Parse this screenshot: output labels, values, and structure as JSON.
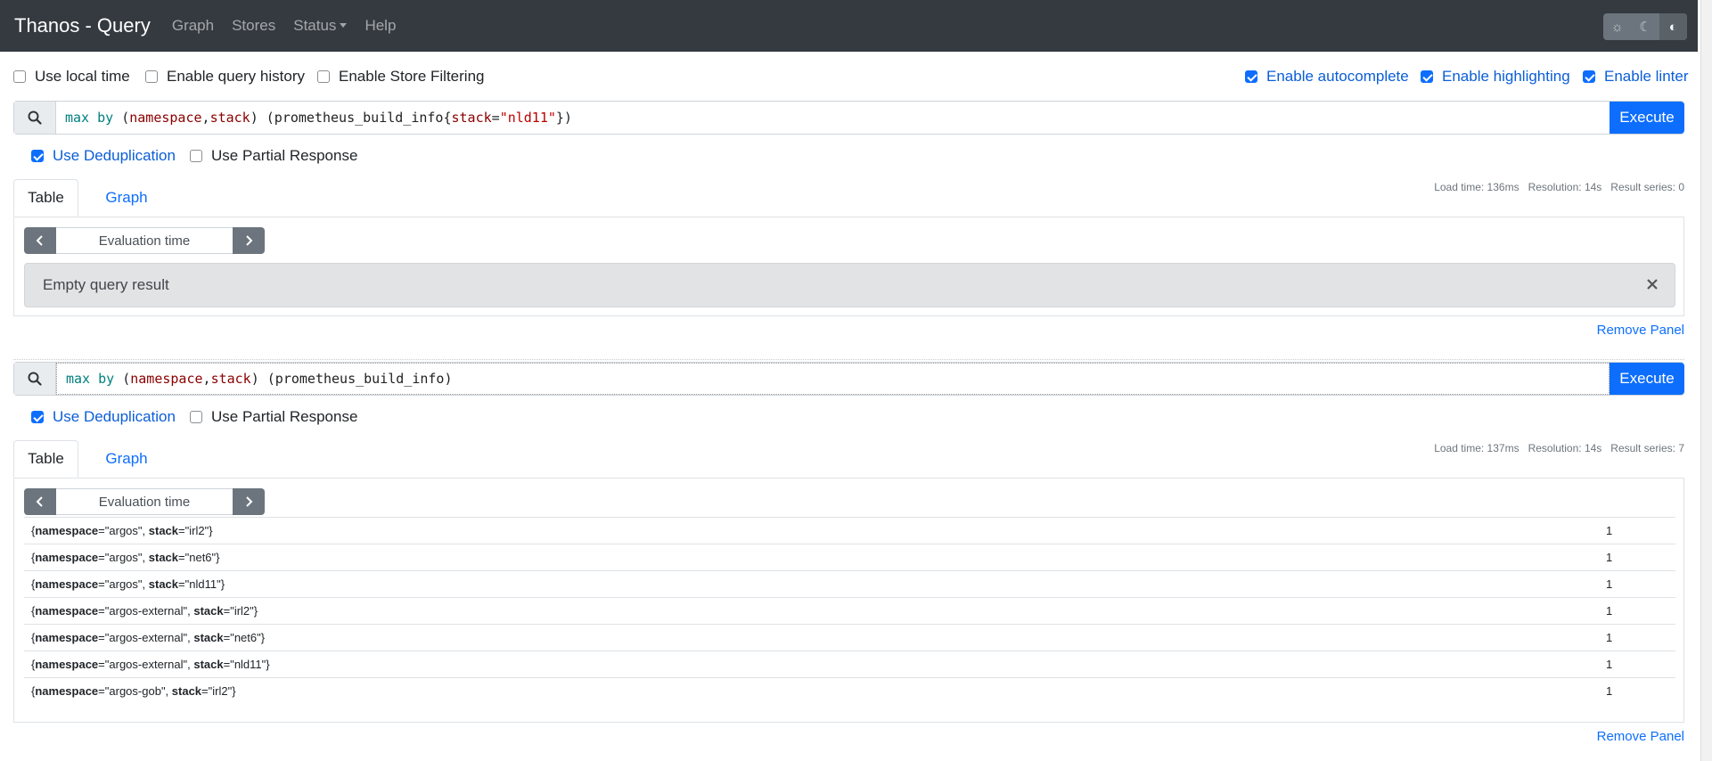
{
  "nav": {
    "brand": "Thanos - Query",
    "links": [
      "Graph",
      "Stores",
      "Status",
      "Help"
    ]
  },
  "theme": {
    "icons": [
      "☼",
      "☾",
      "◐"
    ]
  },
  "options": {
    "use_local_time": "Use local time",
    "enable_query_history": "Enable query history",
    "enable_store_filtering": "Enable Store Filtering",
    "enable_autocomplete": "Enable autocomplete",
    "enable_highlighting": "Enable highlighting",
    "enable_linter": "Enable linter"
  },
  "panels": [
    {
      "query": {
        "p1": "max",
        "p2": " ",
        "p3": "by",
        "p4": " (",
        "p5": "namespace",
        "p6": ",",
        "p7": "stack",
        "p8": ") (prometheus_build_info{",
        "p9": "stack",
        "p10": "=",
        "p11": "\"nld11\"",
        "p12": "})"
      },
      "execute": "Execute",
      "use_dedup": "Use Deduplication",
      "use_partial": "Use Partial Response",
      "tab_table": "Table",
      "tab_graph": "Graph",
      "stats": "Load time: 136ms   Resolution: 14s   Result series: 0",
      "eval_time": "Evaluation time",
      "empty": "Empty query result",
      "remove": "Remove Panel"
    },
    {
      "query": {
        "p1": "max",
        "p2": " ",
        "p3": "by",
        "p4": " (",
        "p5": "namespace",
        "p6": ",",
        "p7": "stack",
        "p8": ") (prometheus_build_info)"
      },
      "execute": "Execute",
      "use_dedup": "Use Deduplication",
      "use_partial": "Use Partial Response",
      "tab_table": "Table",
      "tab_graph": "Graph",
      "stats": "Load time: 137ms   Resolution: 14s   Result series: 7",
      "eval_time": "Evaluation time",
      "remove": "Remove Panel",
      "rows": [
        {
          "ns": "argos",
          "stack": "irl2",
          "value": "1"
        },
        {
          "ns": "argos",
          "stack": "net6",
          "value": "1"
        },
        {
          "ns": "argos",
          "stack": "nld11",
          "value": "1"
        },
        {
          "ns": "argos-external",
          "stack": "irl2",
          "value": "1"
        },
        {
          "ns": "argos-external",
          "stack": "net6",
          "value": "1"
        },
        {
          "ns": "argos-external",
          "stack": "nld11",
          "value": "1"
        },
        {
          "ns": "argos-gob",
          "stack": "irl2",
          "value": "1"
        }
      ]
    }
  ]
}
